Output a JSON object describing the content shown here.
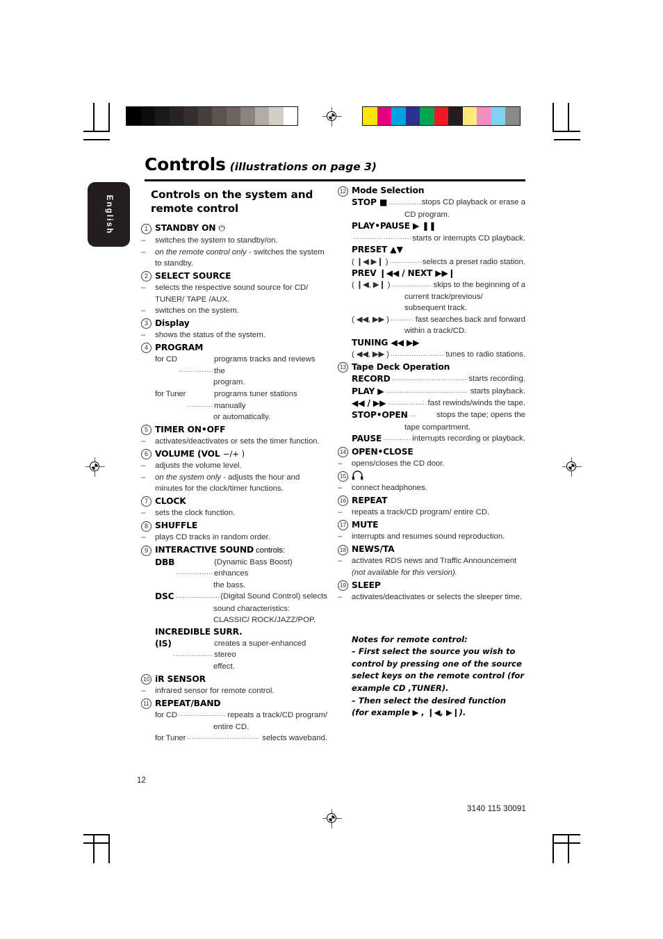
{
  "printer_marks": {
    "grayscale_swatches": [
      "#000000",
      "#0d0c0c",
      "#1a1818",
      "#262322",
      "#332f2d",
      "#473f3c",
      "#5d5450",
      "#6e6560",
      "#8a827c",
      "#b3aca6",
      "#d2cdc7",
      "#ffffff"
    ],
    "color_swatches": [
      "#ffe600",
      "#e5007e",
      "#00a0e3",
      "#2e3192",
      "#00a651",
      "#ed1c24",
      "#231f20",
      "#fdea7b",
      "#f18fc0",
      "#7fd4f5",
      "#8a8a8a"
    ]
  },
  "header": {
    "title": "Controls",
    "subtitle": "(illustrations on page 3)"
  },
  "language_tab": {
    "label": "English"
  },
  "left_column": {
    "heading": "Controls on the system and remote control",
    "items": [
      {
        "number": "1",
        "label": "STANDBY ON",
        "symbol": "⏻",
        "lines": [
          {
            "type": "dash",
            "text": "switches the system to standby/on."
          },
          {
            "type": "dash",
            "italic_lead": "on the remote control only",
            "text": " - switches the system to standby."
          }
        ]
      },
      {
        "number": "2",
        "label": "SELECT SOURCE",
        "lines": [
          {
            "type": "dash",
            "text": "selects the respective sound source for CD/ TUNER/ TAPE /AUX."
          },
          {
            "type": "dash",
            "text": "switches on the system."
          }
        ]
      },
      {
        "number": "3",
        "label": "Display",
        "lines": [
          {
            "type": "dash",
            "text": "shows the status of the system."
          }
        ]
      },
      {
        "number": "4",
        "label": "PROGRAM",
        "defs": [
          {
            "term": "for CD",
            "plain": true,
            "desc": "programs tracks and reviews the",
            "cont": "program."
          },
          {
            "term": "for Tuner",
            "plain": true,
            "desc": "programs tuner stations manually",
            "cont": "or automatically."
          }
        ]
      },
      {
        "number": "5",
        "label": "TIMER ON•OFF",
        "lines": [
          {
            "type": "dash",
            "text": "activates/deactivates or sets the timer function."
          }
        ]
      },
      {
        "number": "6",
        "label": "VOLUME (VOL",
        "symbol": "−/+ )",
        "lines": [
          {
            "type": "dash",
            "text": "adjusts the volume level."
          },
          {
            "type": "dash",
            "italic_lead": "on the system only",
            "text": " - adjusts the hour and minutes for the clock/timer functions."
          }
        ]
      },
      {
        "number": "7",
        "label": "CLOCK",
        "lines": [
          {
            "type": "dash",
            "text": "sets the clock function."
          }
        ]
      },
      {
        "number": "8",
        "label": "SHUFFLE",
        "lines": [
          {
            "type": "dash",
            "text": "plays CD tracks in random order."
          }
        ]
      },
      {
        "number": "9",
        "label": "INTERACTIVE SOUND",
        "label_suffix": " controls:",
        "defs": [
          {
            "term": "DBB",
            "desc": "(Dynamic Bass Boost) enhances",
            "cont": "the bass."
          },
          {
            "term": "DSC",
            "desc": "(Digital Sound Control) selects",
            "cont": "sound characteristics: CLASSIC/ ROCK/JAZZ/POP."
          }
        ],
        "bold_line": "INCREDIBLE SURR.",
        "defs2": [
          {
            "term": "(IS)",
            "desc": "creates a super-enhanced stereo",
            "cont": "effect."
          }
        ]
      },
      {
        "number": "10",
        "label": "iR SENSOR",
        "lines": [
          {
            "type": "dash",
            "text": "infrared sensor for remote control."
          }
        ]
      },
      {
        "number": "11",
        "label": "REPEAT/BAND",
        "defs": [
          {
            "term": "for CD",
            "plain": true,
            "desc": "repeats a track/CD program/",
            "cont": "entire CD."
          },
          {
            "term": "for Tuner",
            "plain": true,
            "desc": "selects waveband.",
            "cont": ""
          }
        ]
      }
    ]
  },
  "right_column": {
    "items": [
      {
        "number": "12",
        "label": "Mode Selection",
        "label_style": "mixed",
        "defs": [
          {
            "term": "STOP ■",
            "desc": "stops CD playback or erase a",
            "cont": "CD program."
          }
        ],
        "blocks": [
          {
            "bold": "PLAY•PAUSE  ▶ ❚❚",
            "lead_desc": "starts or interrupts CD playback."
          },
          {
            "bold": "PRESET ▲▼",
            "paren": "( ❙◀ ▶❙ )",
            "desc": "selects a preset radio station."
          },
          {
            "bold": "PREV ❙◀◀ / NEXT ▶▶❙",
            "paren": "( ❙◀, ▶❙ )",
            "desc": "skips to the beginning of a",
            "cont": "current track/previous/ subsequent track."
          },
          {
            "paren": "( ◀◀, ▶▶ )",
            "desc": "fast searches back and forward",
            "cont": "within a track/CD."
          },
          {
            "bold": "TUNING ◀◀  ▶▶",
            "paren": "( ◀◀, ▶▶ )",
            "desc": "tunes to radio stations."
          }
        ]
      },
      {
        "number": "13",
        "label": "Tape Deck Operation",
        "label_style": "mixed",
        "defs": [
          {
            "term": "RECORD",
            "desc": "starts recording."
          },
          {
            "term": "PLAY ▶",
            "desc": "starts playback."
          },
          {
            "term": "◀◀ / ▶▶",
            "desc": "fast rewinds/winds the tape."
          },
          {
            "term": "STOP•OPEN",
            "desc": "stops the tape; opens the",
            "cont": "tape compartment."
          },
          {
            "term": "PAUSE",
            "desc": "interrupts recording or playback."
          }
        ]
      },
      {
        "number": "14",
        "label": "OPEN•CLOSE",
        "lines": [
          {
            "type": "dash",
            "text": "opens/closes the CD door."
          }
        ]
      },
      {
        "number": "15",
        "label": "",
        "symbol": "headphones-icon",
        "lines": [
          {
            "type": "dash",
            "text": "connect headphones."
          }
        ]
      },
      {
        "number": "16",
        "label": "REPEAT",
        "lines": [
          {
            "type": "dash",
            "text": "repeats a track/CD program/ entire CD."
          }
        ]
      },
      {
        "number": "17",
        "label": "MUTE",
        "lines": [
          {
            "type": "dash",
            "text": "interrupts and resumes sound reproduction."
          }
        ]
      },
      {
        "number": "18",
        "label": "NEWS/TA",
        "lines": [
          {
            "type": "dash",
            "text": "activates RDS news and Traffic Announcement",
            "italic_tail": "(not available for this version)."
          }
        ]
      },
      {
        "number": "19",
        "label": "SLEEP",
        "lines": [
          {
            "type": "dash",
            "text": "activates/deactivates or selects the sleeper time."
          }
        ]
      }
    ],
    "notes": {
      "title": "Notes for remote control:",
      "line1": "–  First select the source you wish to control by pressing one of the source select keys on the remote control (for example CD ,TUNER).",
      "line2": "–  Then select the desired function (for example ▶ ,  ❙◀,  ▶❙)."
    }
  },
  "footer": {
    "page_number": "12",
    "document_id": "3140 115 30091"
  }
}
